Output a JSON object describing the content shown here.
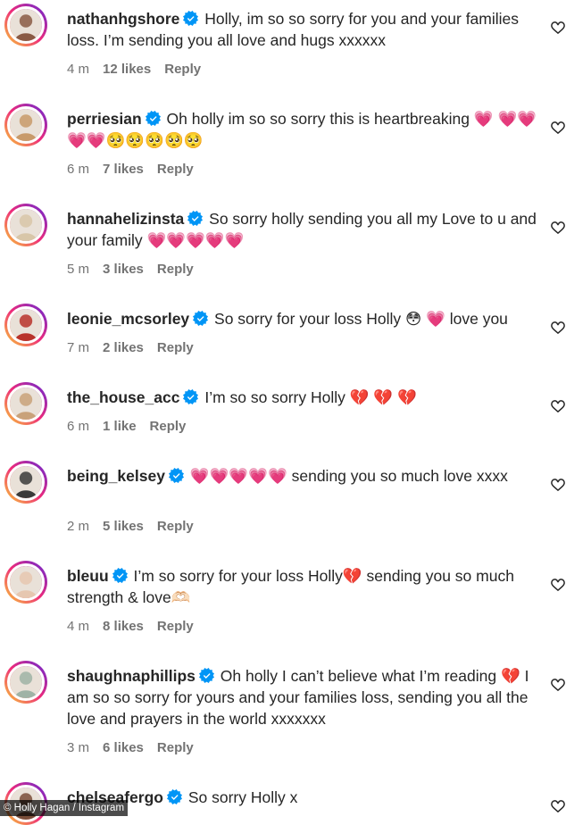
{
  "comments": [
    {
      "username": "nathanhgshore",
      "text": "Holly, im so so sorry for you and your families loss. I’m sending you all love and hugs xxxxxx",
      "time": "4 m",
      "likes": "12 likes",
      "reply": "Reply",
      "avatar_color": "#8a5a44"
    },
    {
      "username": "perriesian",
      "text": "Oh holly im so so sorry this is heartbreaking 💗 💗💗💗💗🥺🥺🥺🥺🥺",
      "time": "6 m",
      "likes": "7 likes",
      "reply": "Reply",
      "avatar_color": "#c89a6a"
    },
    {
      "username": "hannahelizinsta",
      "text": "So sorry holly sending you all my Love to u and your family 💗💗💗💗💗",
      "time": "5 m",
      "likes": "3 likes",
      "reply": "Reply",
      "avatar_color": "#d8c6a8"
    },
    {
      "username": "leonie_mcsorley",
      "text": "So sorry for your loss Holly 😳 💗 love you",
      "time": "7 m",
      "likes": "2 likes",
      "reply": "Reply",
      "avatar_color": "#b8322a"
    },
    {
      "username": "the_house_acc",
      "text": "I’m so so sorry Holly 💔 💔 💔",
      "time": "6 m",
      "likes": "1 like",
      "reply": "Reply",
      "avatar_color": "#c9a27a"
    },
    {
      "username": "being_kelsey",
      "text": "💗💗💗💗💗 sending you so much love xxxx",
      "time": "2 m",
      "likes": "5 likes",
      "reply": "Reply",
      "avatar_color": "#3a3a3a"
    },
    {
      "username": "bleuu",
      "text": "I’m so sorry for your loss Holly💔 sending you so much strength & love🫶🏻",
      "time": "4 m",
      "likes": "8 likes",
      "reply": "Reply",
      "avatar_color": "#e6c7b0"
    },
    {
      "username": "shaughnaphillips",
      "text": "Oh holly I can’t believe what I’m reading 💔 I am so so sorry for yours and your families loss, sending you all the love and prayers in the world xxxxxxx",
      "time": "3 m",
      "likes": "6 likes",
      "reply": "Reply",
      "avatar_color": "#9fb3a6"
    },
    {
      "username": "chelseafergo",
      "text": "So sorry Holly x",
      "time": "",
      "likes": "",
      "reply": "",
      "avatar_color": "#7a4e3a"
    }
  ],
  "credit": "© Holly Hagan / Instagram",
  "colors": {
    "text": "#262626",
    "meta": "#737373",
    "verified": "#0095f6"
  },
  "icons": {
    "verified": "verified-badge-icon",
    "like": "heart-outline-icon"
  }
}
